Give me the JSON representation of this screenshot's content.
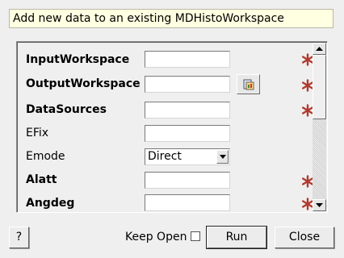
{
  "description": "Add new data to an existing MDHistoWorkspace",
  "properties": [
    {
      "label": "InputWorkspace",
      "bold": true,
      "required": true,
      "value": ""
    },
    {
      "label": "OutputWorkspace",
      "bold": true,
      "required": true,
      "value": "",
      "has_browse": true
    },
    {
      "label": "DataSources",
      "bold": true,
      "required": true,
      "value": ""
    },
    {
      "label": "EFix",
      "bold": false,
      "required": false,
      "value": ""
    },
    {
      "label": "Emode",
      "bold": false,
      "required": false,
      "type": "select",
      "value": "Direct"
    },
    {
      "label": "Alatt",
      "bold": true,
      "required": true,
      "value": ""
    },
    {
      "label": "Angdeg",
      "bold": true,
      "required": true,
      "value": ""
    }
  ],
  "footer": {
    "help_label": "?",
    "keep_open_label": "Keep Open",
    "keep_open_checked": false,
    "run_label": "Run",
    "close_label": "Close"
  },
  "colors": {
    "required_star": "#b03a2e",
    "description_bg": "#ffffe1"
  }
}
